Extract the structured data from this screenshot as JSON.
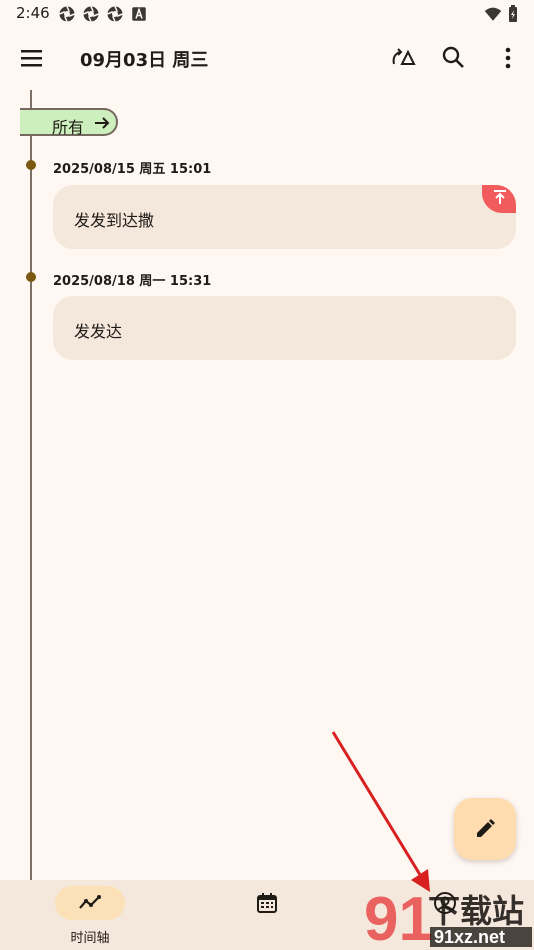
{
  "status_bar": {
    "time": "2:46",
    "left_icons": [
      "aperture-icon",
      "aperture-icon",
      "aperture-icon",
      "font-a-icon"
    ],
    "right_icons": [
      "wifi-icon",
      "battery-icon"
    ]
  },
  "app_bar": {
    "title": "09月03日 周三",
    "actions": [
      "swap-icon",
      "search-icon",
      "more-vert-icon"
    ]
  },
  "filter_chip": {
    "label": "所有"
  },
  "entries": [
    {
      "date": "2025/08/15 周五 15:01",
      "text": "发发到达撒",
      "pinned": true
    },
    {
      "date": "2025/08/18 周一 15:31",
      "text": "发发达",
      "pinned": false
    }
  ],
  "fab": {
    "icon": "edit-icon"
  },
  "bottom_nav": [
    {
      "label": "时间轴",
      "icon": "timeline-icon",
      "active": true
    },
    {
      "label": "",
      "icon": "calendar-icon",
      "active": false
    },
    {
      "label": "",
      "icon": "account-icon",
      "active": false
    }
  ],
  "watermark": {
    "brand": "下载站",
    "domain": "91xz.net"
  },
  "colors": {
    "background": "#fff7f2",
    "card": "#f4e7dc",
    "chip": "#cdeebd",
    "fab": "#ffdcb0",
    "pin": "#f25b5b",
    "timeline_dot": "#7a5a10",
    "annotation_arrow": "#d82020"
  }
}
